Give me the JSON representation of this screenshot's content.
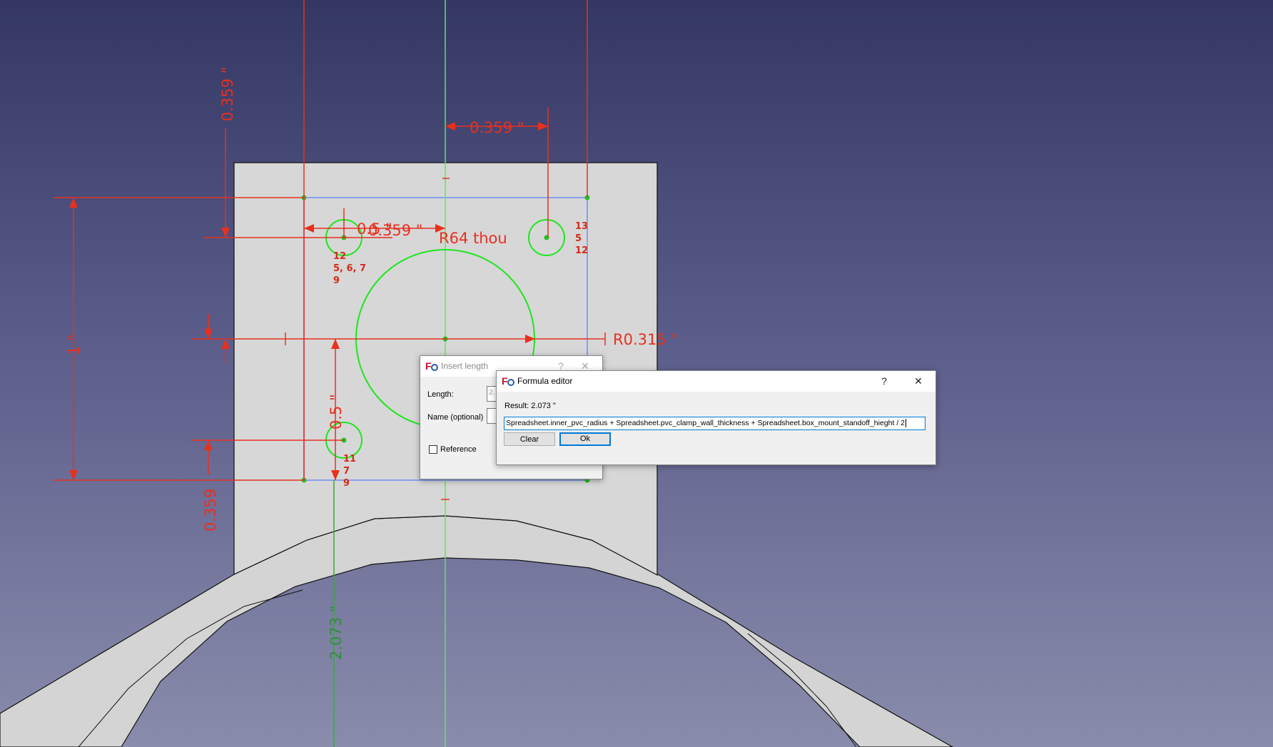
{
  "sketch": {
    "dimensions": {
      "top_vertical": "0.359 \"",
      "top_horizontal": "0.359 \"",
      "left_overlap": "0.359 \"",
      "left_overlap_stacked": "0.5 \"",
      "radius_small": "R64 thou",
      "radius_large": "R0.315 \"",
      "height": "1 \"",
      "lower_vertical": "0.5 \"",
      "bottom_vertical": "0.359",
      "reference_length": "2.073 \""
    },
    "constraints": {
      "hole_tl_a": "12",
      "hole_tl_b": "5, 6, 7",
      "hole_tl_c": "9",
      "hole_tr_a": "13",
      "hole_tr_b": "5",
      "hole_tr_c": "12",
      "hole_bl_a": "11",
      "hole_bl_b": "7",
      "hole_bl_c": "9"
    },
    "colors": {
      "constraint": "#e8301e",
      "geometry": "#1ee61e",
      "construction": "#8aa0f0",
      "reference": "#2f8f3a"
    }
  },
  "insert_length_dialog": {
    "title": "Insert length",
    "help": "?",
    "close": "✕",
    "length_label": "Length:",
    "length_value": "2.",
    "name_label": "Name (optional)",
    "reference_label": "Reference",
    "reference_checked": false
  },
  "formula_editor": {
    "title": "Formula editor",
    "help": "?",
    "close": "✕",
    "result": "Result:  2.073 \"",
    "formula": "Spreadsheet.inner_pvc_radius + Spreadsheet.pvc_clamp_wall_thickness + Spreadsheet.box_mount_standoff_hieght / 2",
    "clear_label": "Clear",
    "ok_label": "Ok"
  }
}
